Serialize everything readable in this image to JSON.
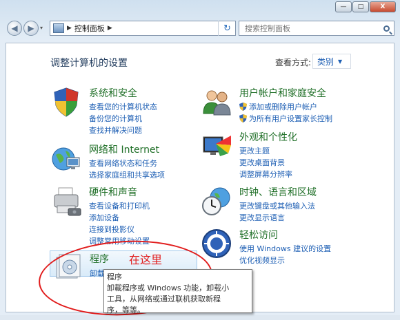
{
  "caption": {
    "minimize": "—",
    "maximize": "□",
    "close": "X"
  },
  "nav": {
    "back": "◀",
    "forward": "▶",
    "recent": "▾",
    "breadcrumb": "控制面板",
    "refresh": "↻",
    "search_placeholder": "搜索控制面板"
  },
  "page_title": "调整计算机的设置",
  "view": {
    "label": "查看方式:",
    "value": "类别"
  },
  "categories": [
    {
      "title": "系统和安全",
      "links": [
        "查看您的计算机状态",
        "备份您的计算机",
        "查找并解决问题"
      ]
    },
    {
      "title": "网络和 Internet",
      "links": [
        "查看网络状态和任务",
        "选择家庭组和共享选项"
      ]
    },
    {
      "title": "硬件和声音",
      "links": [
        "查看设备和打印机",
        "添加设备",
        "连接到投影仪",
        "调整常用移动设置"
      ]
    },
    {
      "title": "程序",
      "links": [
        "卸载程序"
      ]
    },
    {
      "title": "用户帐户和家庭安全",
      "links": [
        "添加或删除用户帐户",
        "为所有用户设置家长控制"
      ]
    },
    {
      "title": "外观和个性化",
      "links": [
        "更改主题",
        "更改桌面背景",
        "调整屏幕分辨率"
      ]
    },
    {
      "title": "时钟、语言和区域",
      "links": [
        "更改键盘或其他输入法",
        "更改显示语言"
      ]
    },
    {
      "title": "轻松访问",
      "links": [
        "使用 Windows 建议的设置",
        "优化视频显示"
      ]
    }
  ],
  "annotation": "在这里",
  "tooltip": {
    "title": "程序",
    "line1": "卸載程序或 Windows 功能，卸载小",
    "line2": "工具，从网络或通过联机获取新程",
    "line3": "序，等等。"
  },
  "colors": {
    "heading": "#1f6f27",
    "link": "#1e5fb4",
    "annotation": "#e11b1b"
  }
}
